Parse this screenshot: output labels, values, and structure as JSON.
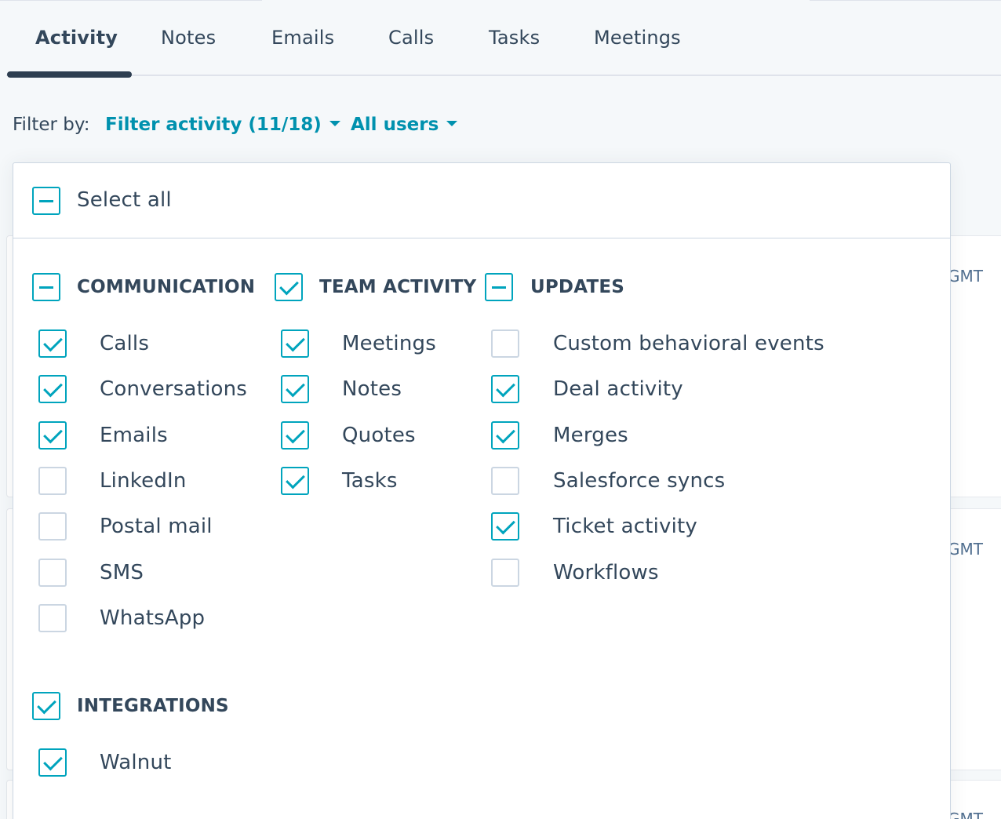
{
  "tabs": [
    {
      "label": "Activity",
      "active": true
    },
    {
      "label": "Notes"
    },
    {
      "label": "Emails"
    },
    {
      "label": "Calls"
    },
    {
      "label": "Tasks"
    },
    {
      "label": "Meetings"
    }
  ],
  "filter": {
    "label": "Filter by:",
    "activity_filter": "Filter activity (11/18)",
    "users_filter": "All users"
  },
  "timeline": {
    "timestamps": [
      "GMT",
      "GMT",
      "GMT"
    ]
  },
  "dropdown": {
    "select_all": {
      "label": "Select all",
      "state": "mixed"
    },
    "groups": {
      "communication": {
        "title": "COMMUNICATION",
        "state": "mixed",
        "items": [
          {
            "label": "Calls",
            "checked": true
          },
          {
            "label": "Conversations",
            "checked": true
          },
          {
            "label": "Emails",
            "checked": true
          },
          {
            "label": "LinkedIn",
            "checked": false
          },
          {
            "label": "Postal mail",
            "checked": false
          },
          {
            "label": "SMS",
            "checked": false
          },
          {
            "label": "WhatsApp",
            "checked": false
          }
        ]
      },
      "team_activity": {
        "title": "TEAM ACTIVITY",
        "state": "checked",
        "items": [
          {
            "label": "Meetings",
            "checked": true
          },
          {
            "label": "Notes",
            "checked": true
          },
          {
            "label": "Quotes",
            "checked": true
          },
          {
            "label": "Tasks",
            "checked": true
          }
        ]
      },
      "updates": {
        "title": "UPDATES",
        "state": "mixed",
        "items": [
          {
            "label": "Custom behavioral events",
            "checked": false
          },
          {
            "label": "Deal activity",
            "checked": true
          },
          {
            "label": "Merges",
            "checked": true
          },
          {
            "label": "Salesforce syncs",
            "checked": false
          },
          {
            "label": "Ticket activity",
            "checked": true
          },
          {
            "label": "Workflows",
            "checked": false
          }
        ]
      },
      "integrations": {
        "title": "INTEGRATIONS",
        "state": "checked",
        "items": [
          {
            "label": "Walnut",
            "checked": true
          }
        ]
      }
    }
  },
  "colors": {
    "accent": "#00a4bd",
    "link": "#0091ae",
    "text": "#33475b",
    "border": "#cbd6e2"
  }
}
